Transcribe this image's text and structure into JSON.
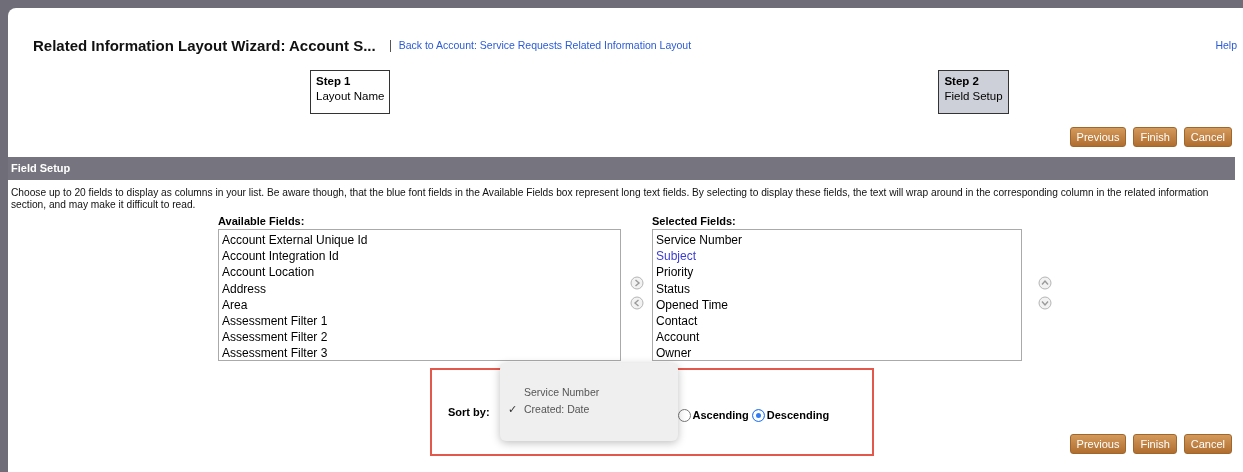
{
  "header": {
    "title": "Related Information Layout Wizard: Account S...",
    "back_link": "Back to Account: Service Requests Related Information Layout",
    "help_link": "Help"
  },
  "steps": [
    {
      "number": "Step 1",
      "label": "Layout Name",
      "selected": false
    },
    {
      "number": "Step 2",
      "label": "Field Setup",
      "selected": true
    }
  ],
  "top_buttons": [
    "Previous",
    "Finish",
    "Cancel"
  ],
  "section": {
    "title": "Field Setup",
    "description": "Choose up to 20 fields to display as columns in your list. Be aware though, that the blue font fields in the Available Fields box represent long text fields. By selecting to display these fields, the text will wrap around in the corresponding column in the related information section, and may make it difficult to read."
  },
  "available_fields": {
    "label": "Available Fields:",
    "items": [
      {
        "text": "Account External Unique Id",
        "long_text": false
      },
      {
        "text": "Account Integration Id",
        "long_text": false
      },
      {
        "text": "Account Location",
        "long_text": false
      },
      {
        "text": "Address",
        "long_text": false
      },
      {
        "text": "Area",
        "long_text": false
      },
      {
        "text": "Assessment Filter 1",
        "long_text": false
      },
      {
        "text": "Assessment Filter 2",
        "long_text": false
      },
      {
        "text": "Assessment Filter 3",
        "long_text": false
      }
    ]
  },
  "selected_fields": {
    "label": "Selected Fields:",
    "items": [
      {
        "text": "Service Number",
        "long_text": false
      },
      {
        "text": "Subject",
        "long_text": true
      },
      {
        "text": "Priority",
        "long_text": false
      },
      {
        "text": "Status",
        "long_text": false
      },
      {
        "text": "Opened Time",
        "long_text": false
      },
      {
        "text": "Contact",
        "long_text": false
      },
      {
        "text": "Account",
        "long_text": false
      },
      {
        "text": "Owner",
        "long_text": false
      }
    ]
  },
  "sort": {
    "label": "Sort by:",
    "options": [
      {
        "text": "Service Number",
        "selected": false
      },
      {
        "text": "Created: Date",
        "selected": true
      }
    ],
    "checkmark": "✓",
    "order": [
      {
        "text": "Ascending",
        "selected": false
      },
      {
        "text": "Descending",
        "selected": true
      }
    ]
  },
  "bottom_buttons": [
    "Previous",
    "Finish",
    "Cancel"
  ]
}
